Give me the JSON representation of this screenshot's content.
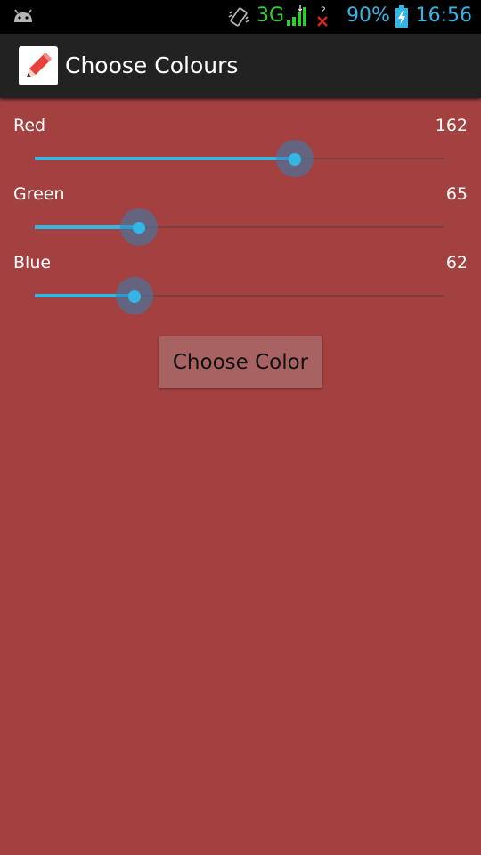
{
  "status_bar": {
    "network_type": "3G",
    "battery_percent": "90%",
    "time": "16:56",
    "sim_slot": "2",
    "icons": [
      "android-icon",
      "vibrate-icon",
      "signal-icon",
      "no-signal-icon",
      "battery-charging-icon"
    ]
  },
  "action_bar": {
    "title": "Choose Colours",
    "icon": "pencil-icon"
  },
  "sliders": [
    {
      "label": "Red",
      "value": "162",
      "max": 255
    },
    {
      "label": "Green",
      "value": "65",
      "max": 255
    },
    {
      "label": "Blue",
      "value": "62",
      "max": 255
    }
  ],
  "choose_button": {
    "label": "Choose Color"
  },
  "colors": {
    "background": "#a34040",
    "accent": "#33b5e5",
    "action_bar": "#222222"
  }
}
